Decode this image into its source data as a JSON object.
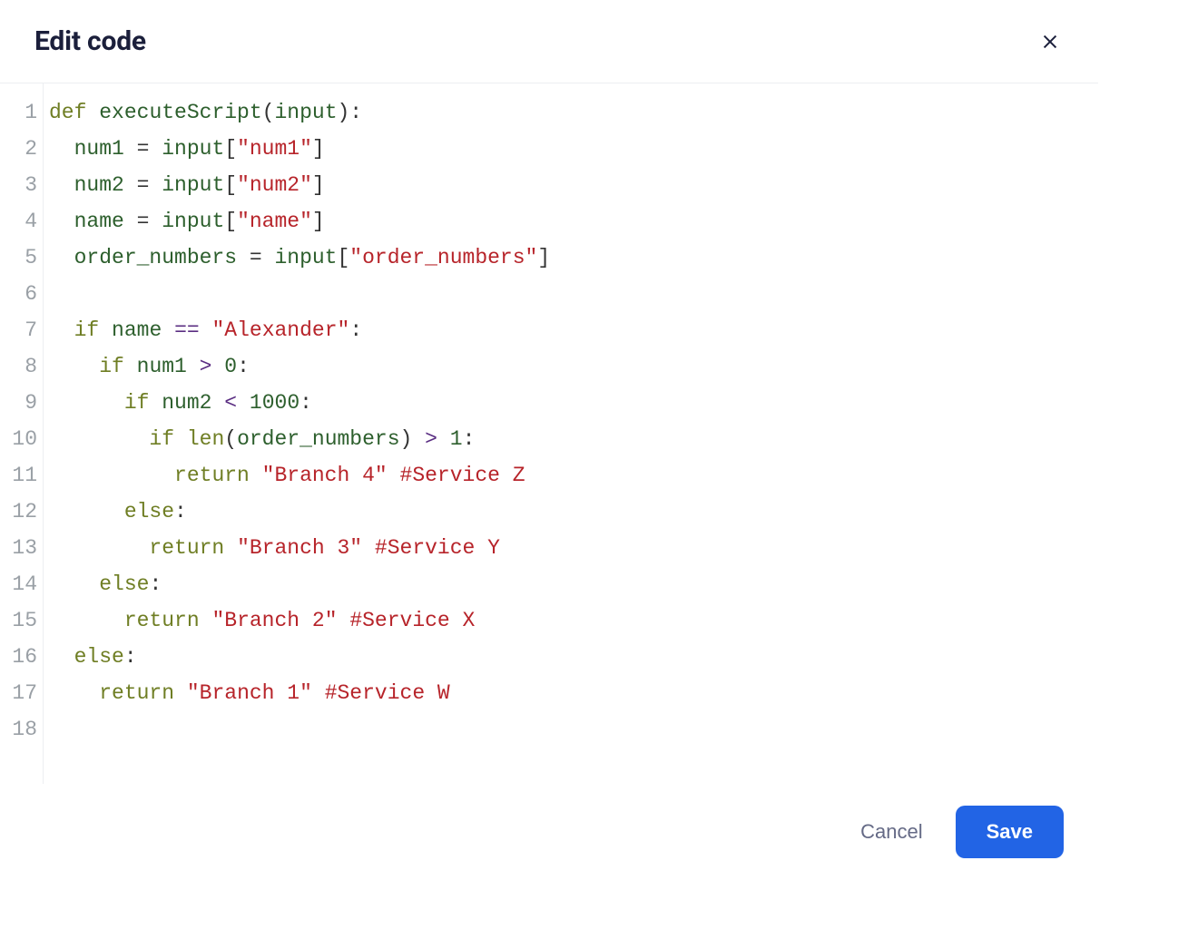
{
  "header": {
    "title": "Edit code"
  },
  "footer": {
    "cancel_label": "Cancel",
    "save_label": "Save"
  },
  "editor": {
    "line_numbers": [
      "1",
      "2",
      "3",
      "4",
      "5",
      "6",
      "7",
      "8",
      "9",
      "10",
      "11",
      "12",
      "13",
      "14",
      "15",
      "16",
      "17",
      "18"
    ],
    "lines": [
      [
        {
          "c": "kw",
          "t": "def"
        },
        {
          "c": "pn",
          "t": " "
        },
        {
          "c": "fn",
          "t": "executeScript"
        },
        {
          "c": "pn",
          "t": "("
        },
        {
          "c": "id",
          "t": "input"
        },
        {
          "c": "pn",
          "t": "):"
        }
      ],
      [
        {
          "c": "pn",
          "t": "  "
        },
        {
          "c": "id",
          "t": "num1"
        },
        {
          "c": "pn",
          "t": " = "
        },
        {
          "c": "id",
          "t": "input"
        },
        {
          "c": "pn",
          "t": "["
        },
        {
          "c": "str",
          "t": "\"num1\""
        },
        {
          "c": "pn",
          "t": "]"
        }
      ],
      [
        {
          "c": "pn",
          "t": "  "
        },
        {
          "c": "id",
          "t": "num2"
        },
        {
          "c": "pn",
          "t": " = "
        },
        {
          "c": "id",
          "t": "input"
        },
        {
          "c": "pn",
          "t": "["
        },
        {
          "c": "str",
          "t": "\"num2\""
        },
        {
          "c": "pn",
          "t": "]"
        }
      ],
      [
        {
          "c": "pn",
          "t": "  "
        },
        {
          "c": "id",
          "t": "name"
        },
        {
          "c": "pn",
          "t": " = "
        },
        {
          "c": "id",
          "t": "input"
        },
        {
          "c": "pn",
          "t": "["
        },
        {
          "c": "str",
          "t": "\"name\""
        },
        {
          "c": "pn",
          "t": "]"
        }
      ],
      [
        {
          "c": "pn",
          "t": "  "
        },
        {
          "c": "id",
          "t": "order_numbers"
        },
        {
          "c": "pn",
          "t": " = "
        },
        {
          "c": "id",
          "t": "input"
        },
        {
          "c": "pn",
          "t": "["
        },
        {
          "c": "str",
          "t": "\"order_numbers\""
        },
        {
          "c": "pn",
          "t": "]"
        }
      ],
      [
        {
          "c": "pn",
          "t": ""
        }
      ],
      [
        {
          "c": "pn",
          "t": "  "
        },
        {
          "c": "kw",
          "t": "if"
        },
        {
          "c": "pn",
          "t": " "
        },
        {
          "c": "id",
          "t": "name"
        },
        {
          "c": "pn",
          "t": " "
        },
        {
          "c": "op",
          "t": "=="
        },
        {
          "c": "pn",
          "t": " "
        },
        {
          "c": "str",
          "t": "\"Alexander\""
        },
        {
          "c": "pn",
          "t": ":"
        }
      ],
      [
        {
          "c": "pn",
          "t": "    "
        },
        {
          "c": "kw",
          "t": "if"
        },
        {
          "c": "pn",
          "t": " "
        },
        {
          "c": "id",
          "t": "num1"
        },
        {
          "c": "pn",
          "t": " "
        },
        {
          "c": "op",
          "t": ">"
        },
        {
          "c": "pn",
          "t": " "
        },
        {
          "c": "num",
          "t": "0"
        },
        {
          "c": "pn",
          "t": ":"
        }
      ],
      [
        {
          "c": "pn",
          "t": "      "
        },
        {
          "c": "kw",
          "t": "if"
        },
        {
          "c": "pn",
          "t": " "
        },
        {
          "c": "id",
          "t": "num2"
        },
        {
          "c": "pn",
          "t": " "
        },
        {
          "c": "op",
          "t": "<"
        },
        {
          "c": "pn",
          "t": " "
        },
        {
          "c": "num",
          "t": "1000"
        },
        {
          "c": "pn",
          "t": ":"
        }
      ],
      [
        {
          "c": "pn",
          "t": "        "
        },
        {
          "c": "kw",
          "t": "if"
        },
        {
          "c": "pn",
          "t": " "
        },
        {
          "c": "bi",
          "t": "len"
        },
        {
          "c": "pn",
          "t": "("
        },
        {
          "c": "id",
          "t": "order_numbers"
        },
        {
          "c": "pn",
          "t": ") "
        },
        {
          "c": "op",
          "t": ">"
        },
        {
          "c": "pn",
          "t": " "
        },
        {
          "c": "num",
          "t": "1"
        },
        {
          "c": "pn",
          "t": ":"
        }
      ],
      [
        {
          "c": "pn",
          "t": "          "
        },
        {
          "c": "kw",
          "t": "return"
        },
        {
          "c": "pn",
          "t": " "
        },
        {
          "c": "str",
          "t": "\"Branch 4\""
        },
        {
          "c": "pn",
          "t": " "
        },
        {
          "c": "cmt",
          "t": "#Service Z"
        }
      ],
      [
        {
          "c": "pn",
          "t": "      "
        },
        {
          "c": "kw",
          "t": "else"
        },
        {
          "c": "pn",
          "t": ":"
        }
      ],
      [
        {
          "c": "pn",
          "t": "        "
        },
        {
          "c": "kw",
          "t": "return"
        },
        {
          "c": "pn",
          "t": " "
        },
        {
          "c": "str",
          "t": "\"Branch 3\""
        },
        {
          "c": "pn",
          "t": " "
        },
        {
          "c": "cmt",
          "t": "#Service Y"
        }
      ],
      [
        {
          "c": "pn",
          "t": "    "
        },
        {
          "c": "kw",
          "t": "else"
        },
        {
          "c": "pn",
          "t": ":"
        }
      ],
      [
        {
          "c": "pn",
          "t": "      "
        },
        {
          "c": "kw",
          "t": "return"
        },
        {
          "c": "pn",
          "t": " "
        },
        {
          "c": "str",
          "t": "\"Branch 2\""
        },
        {
          "c": "pn",
          "t": " "
        },
        {
          "c": "cmt",
          "t": "#Service X"
        }
      ],
      [
        {
          "c": "pn",
          "t": "  "
        },
        {
          "c": "kw",
          "t": "else"
        },
        {
          "c": "pn",
          "t": ":"
        }
      ],
      [
        {
          "c": "pn",
          "t": "    "
        },
        {
          "c": "kw",
          "t": "return"
        },
        {
          "c": "pn",
          "t": " "
        },
        {
          "c": "str",
          "t": "\"Branch 1\""
        },
        {
          "c": "pn",
          "t": " "
        },
        {
          "c": "cmt",
          "t": "#Service W"
        }
      ],
      [
        {
          "c": "pn",
          "t": ""
        }
      ]
    ]
  }
}
